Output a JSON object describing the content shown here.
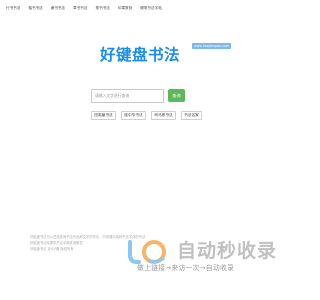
{
  "nav": {
    "items": [
      {
        "label": "行书书法"
      },
      {
        "label": "楷书书法"
      },
      {
        "label": "隶书书法"
      },
      {
        "label": "草书书法"
      },
      {
        "label": "篆书书法"
      },
      {
        "label": "印章篆刻"
      },
      {
        "label": "硬笔书法字帖"
      }
    ]
  },
  "brand": {
    "title": "好键盘书法",
    "domain": "www.haojianpan.com"
  },
  "search": {
    "placeholder": "请输入文字进行查询",
    "button_label": "查询"
  },
  "styles": {
    "items": [
      {
        "label": "田英章书法"
      },
      {
        "label": "庞中华书法"
      },
      {
        "label": "司马彦书法"
      },
      {
        "label": "书法名家"
      }
    ]
  },
  "footer": {
    "lines": [
      "好键盘书法可以在线查询书法作品和文字的写法，向你展示各种书法字体的写法",
      "好键盘书法网提供书法字典查询服务",
      "好键盘书法 京ICP备 版权所有"
    ]
  },
  "watermark": {
    "text": "自动秒收录",
    "slogan": "做上链接→来访一次→自动收录"
  },
  "colors": {
    "brand_blue": "#1a8fe3",
    "badge_blue": "#7db8ea",
    "search_green": "#5cb85c",
    "watermark_gray": "#c0c0c0"
  }
}
